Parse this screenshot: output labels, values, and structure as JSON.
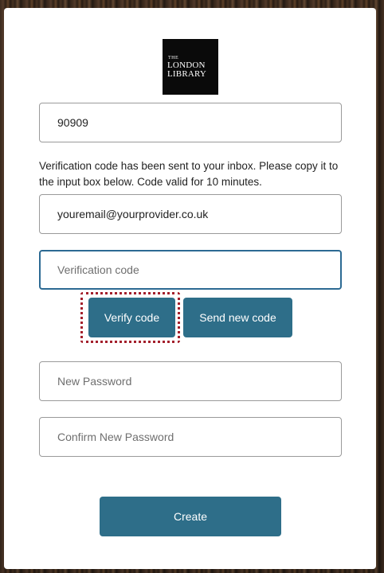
{
  "logo": {
    "line1": "THE",
    "line2": "LONDON",
    "line3": "LIBRARY"
  },
  "form": {
    "membership_number": "90909",
    "info_text": "Verification code has been sent to your inbox. Please copy it to the input box below. Code valid for 10 minutes.",
    "email": "youremail@yourprovider.co.uk",
    "verification_placeholder": "Verification code",
    "verify_button": "Verify code",
    "send_new_code_button": "Send new code",
    "new_password_placeholder": "New Password",
    "confirm_password_placeholder": "Confirm New Password",
    "create_button": "Create"
  },
  "colors": {
    "button": "#2e6e89",
    "focus_border": "#2c6a93",
    "focus_ring": "#a3202c"
  }
}
